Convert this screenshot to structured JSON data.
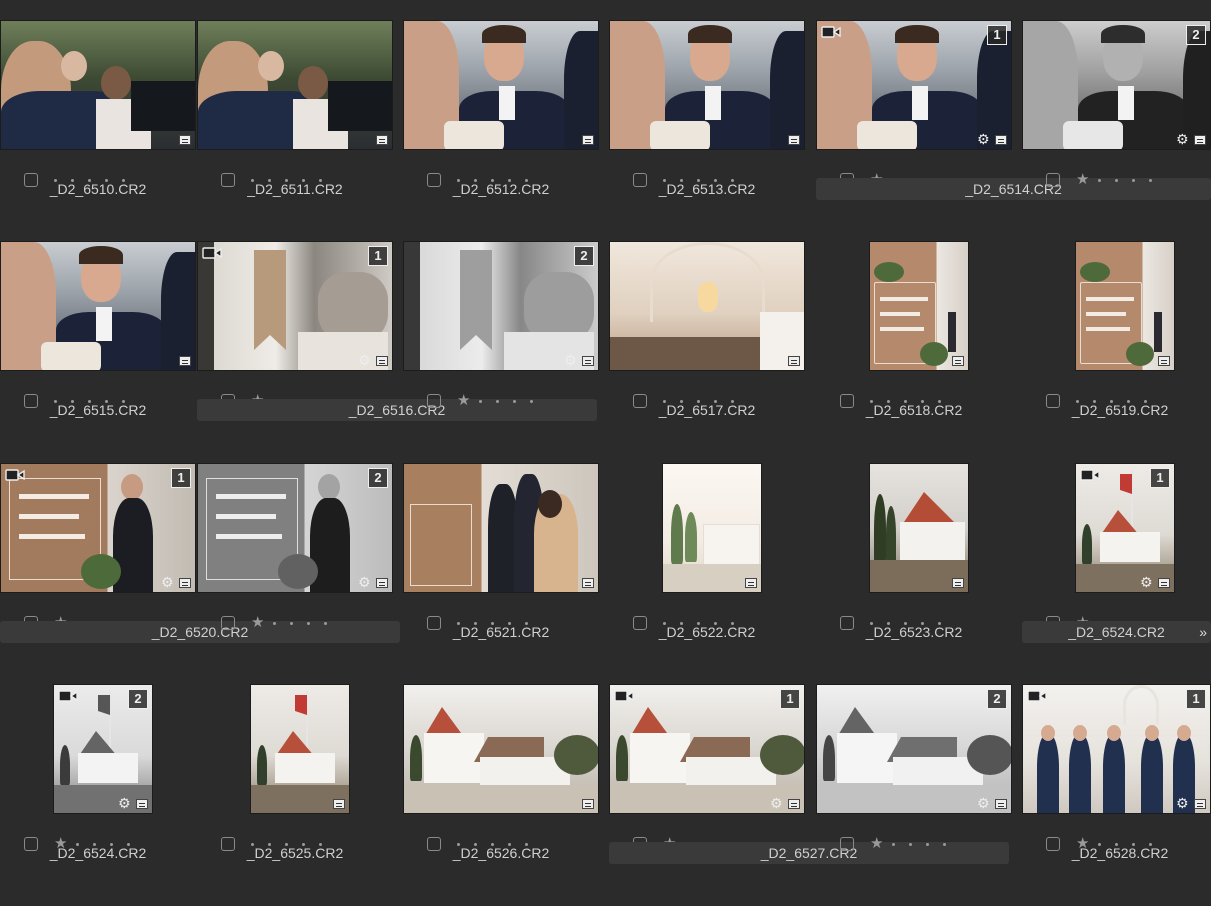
{
  "icons": {
    "video": "video-camera-icon",
    "note": "note-icon",
    "gear": "gear-icon",
    "expand": "chevron-double-right-icon"
  },
  "expand_glyph": "»",
  "rows": [
    [
      {
        "name": "_D2_6510.CR2",
        "scene": "guests",
        "star": false
      },
      {
        "name": "_D2_6511.CR2",
        "scene": "guests",
        "star": false
      },
      {
        "name": "_D2_6512.CR2",
        "scene": "groom",
        "star": false
      },
      {
        "name": "_D2_6513.CR2",
        "scene": "groom",
        "star": false
      },
      {
        "name": "_D2_6514.CR2",
        "scene": "groom",
        "star": true,
        "badge": "1",
        "video": true,
        "gear": true,
        "stack": true
      },
      {
        "name": "",
        "scene": "groom",
        "bw": true,
        "star": true,
        "badge": "2",
        "gear": true,
        "stackmember": true
      }
    ],
    [
      {
        "name": "_D2_6515.CR2",
        "scene": "groom",
        "star": false
      },
      {
        "name": "_D2_6516.CR2",
        "scene": "sign",
        "star": true,
        "badge": "1",
        "video": true,
        "gear": true,
        "stack": true
      },
      {
        "name": "",
        "scene": "sign",
        "bw": true,
        "star": true,
        "badge": "2",
        "gear": true,
        "stackmember": true
      },
      {
        "name": "_D2_6517.CR2",
        "scene": "nave",
        "star": false
      },
      {
        "name": "_D2_6518.CR2",
        "scene": "welcome",
        "star": false,
        "portrait": true
      },
      {
        "name": "_D2_6519.CR2",
        "scene": "welcome",
        "star": false,
        "portrait": true
      }
    ],
    [
      {
        "name": "_D2_6520.CR2",
        "scene": "welcome_man",
        "star": true,
        "badge": "1",
        "video": true,
        "gear": true,
        "stack": true
      },
      {
        "name": "",
        "scene": "welcome_man",
        "bw": true,
        "star": true,
        "badge": "2",
        "gear": true,
        "stackmember": true
      },
      {
        "name": "_D2_6521.CR2",
        "scene": "welcome_people",
        "star": false
      },
      {
        "name": "_D2_6522.CR2",
        "scene": "bright_church",
        "star": false,
        "portrait": true
      },
      {
        "name": "_D2_6523.CR2",
        "scene": "church",
        "star": false,
        "portrait": true
      },
      {
        "name": "_D2_6524.CR2",
        "scene": "church_flag",
        "star": true,
        "badge": "1",
        "video": true,
        "gear": true,
        "stack": true,
        "portrait": true
      }
    ],
    [
      {
        "name": "_D2_6524.CR2",
        "scene": "church_flag",
        "bw": true,
        "star": true,
        "badge": "2",
        "video": true,
        "gear": true,
        "stackmember": true,
        "portrait": true
      },
      {
        "name": "_D2_6525.CR2",
        "scene": "church_flag",
        "star": false,
        "portrait": true
      },
      {
        "name": "_D2_6526.CR2",
        "scene": "church_wide",
        "star": false
      },
      {
        "name": "_D2_6527.CR2",
        "scene": "church_wide",
        "star": true,
        "badge": "1",
        "video": true,
        "gear": true,
        "stack": true
      },
      {
        "name": "",
        "scene": "church_wide",
        "bw": true,
        "star": true,
        "badge": "2",
        "gear": true,
        "stackmember": true
      },
      {
        "name": "_D2_6528.CR2",
        "scene": "groomsmen",
        "star": true,
        "badge": "1",
        "video": true,
        "gear": true
      }
    ]
  ]
}
